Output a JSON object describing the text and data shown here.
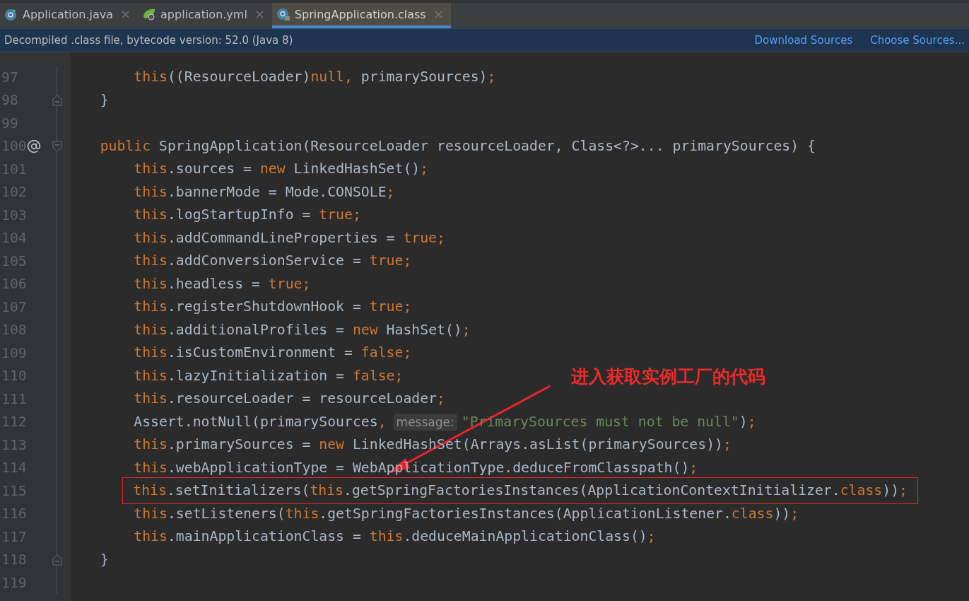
{
  "tabs": [
    {
      "label": "Application.java",
      "kind": "class",
      "selected": false
    },
    {
      "label": "application.yml",
      "kind": "spring",
      "selected": false
    },
    {
      "label": "SpringApplication.class",
      "kind": "locked-class",
      "selected": true
    }
  ],
  "banner": {
    "text": "Decompiled .class file, bytecode version: 52.0 (Java 8)",
    "links": [
      "Download Sources",
      "Choose Sources..."
    ]
  },
  "lines": [
    {
      "number": "97",
      "override": false,
      "fold_start": false,
      "fold_end": false,
      "boxed": false,
      "tokens": [
        {
          "t": "        this",
          "kind": "kw"
        },
        {
          "t": "((ResourceLoader)",
          "kind": "id"
        },
        {
          "t": "null",
          "kind": "kw"
        },
        {
          "t": ",",
          "kind": "kw"
        },
        {
          "t": " primarySources)",
          "kind": "id"
        },
        {
          "t": ";",
          "kind": "kw"
        }
      ]
    },
    {
      "number": "98",
      "override": false,
      "fold_start": false,
      "fold_end": true,
      "boxed": false,
      "tokens": [
        {
          "t": "    }",
          "kind": "id"
        }
      ]
    },
    {
      "number": "99",
      "override": false,
      "fold_start": false,
      "fold_end": false,
      "boxed": false
    },
    {
      "number": "100",
      "override": true,
      "fold_start": true,
      "fold_end": false,
      "boxed": false,
      "tokens": [
        {
          "t": "    public",
          "kind": "kw"
        },
        {
          "t": " SpringApplication(ResourceLoader resourceLoader, Class<?>... primarySources) {",
          "kind": "id"
        }
      ]
    },
    {
      "number": "101",
      "override": false,
      "fold_start": false,
      "fold_end": false,
      "boxed": false,
      "tokens": [
        {
          "t": "        this",
          "kind": "kw"
        },
        {
          "t": ".sources = ",
          "kind": "id"
        },
        {
          "t": "new",
          "kind": "kw"
        },
        {
          "t": " LinkedHashSet()",
          "kind": "id"
        },
        {
          "t": ";",
          "kind": "kw"
        }
      ]
    },
    {
      "number": "102",
      "override": false,
      "fold_start": false,
      "fold_end": false,
      "boxed": false,
      "tokens": [
        {
          "t": "        this",
          "kind": "kw"
        },
        {
          "t": ".bannerMode = Mode.CONSOLE",
          "kind": "id"
        },
        {
          "t": ";",
          "kind": "kw"
        }
      ]
    },
    {
      "number": "103",
      "override": false,
      "fold_start": false,
      "fold_end": false,
      "boxed": false,
      "tokens": [
        {
          "t": "        this",
          "kind": "kw"
        },
        {
          "t": ".logStartupInfo = ",
          "kind": "id"
        },
        {
          "t": "true",
          "kind": "kw"
        },
        {
          "t": ";",
          "kind": "kw"
        }
      ]
    },
    {
      "number": "104",
      "override": false,
      "fold_start": false,
      "fold_end": false,
      "boxed": false,
      "tokens": [
        {
          "t": "        this",
          "kind": "kw"
        },
        {
          "t": ".addCommandLineProperties = ",
          "kind": "id"
        },
        {
          "t": "true",
          "kind": "kw"
        },
        {
          "t": ";",
          "kind": "kw"
        }
      ]
    },
    {
      "number": "105",
      "override": false,
      "fold_start": false,
      "fold_end": false,
      "boxed": false,
      "tokens": [
        {
          "t": "        this",
          "kind": "kw"
        },
        {
          "t": ".addConversionService = ",
          "kind": "id"
        },
        {
          "t": "true",
          "kind": "kw"
        },
        {
          "t": ";",
          "kind": "kw"
        }
      ]
    },
    {
      "number": "106",
      "override": false,
      "fold_start": false,
      "fold_end": false,
      "boxed": false,
      "tokens": [
        {
          "t": "        this",
          "kind": "kw"
        },
        {
          "t": ".headless = ",
          "kind": "id"
        },
        {
          "t": "true",
          "kind": "kw"
        },
        {
          "t": ";",
          "kind": "kw"
        }
      ]
    },
    {
      "number": "107",
      "override": false,
      "fold_start": false,
      "fold_end": false,
      "boxed": false,
      "tokens": [
        {
          "t": "        this",
          "kind": "kw"
        },
        {
          "t": ".registerShutdownHook = ",
          "kind": "id"
        },
        {
          "t": "true",
          "kind": "kw"
        },
        {
          "t": ";",
          "kind": "kw"
        }
      ]
    },
    {
      "number": "108",
      "override": false,
      "fold_start": false,
      "fold_end": false,
      "boxed": false,
      "tokens": [
        {
          "t": "        this",
          "kind": "kw"
        },
        {
          "t": ".additionalProfiles = ",
          "kind": "id"
        },
        {
          "t": "new",
          "kind": "kw"
        },
        {
          "t": " HashSet()",
          "kind": "id"
        },
        {
          "t": ";",
          "kind": "kw"
        }
      ]
    },
    {
      "number": "109",
      "override": false,
      "fold_start": false,
      "fold_end": false,
      "boxed": false,
      "tokens": [
        {
          "t": "        this",
          "kind": "kw"
        },
        {
          "t": ".isCustomEnvironment = ",
          "kind": "id"
        },
        {
          "t": "false",
          "kind": "kw"
        },
        {
          "t": ";",
          "kind": "kw"
        }
      ]
    },
    {
      "number": "110",
      "override": false,
      "fold_start": false,
      "fold_end": false,
      "boxed": false,
      "tokens": [
        {
          "t": "        this",
          "kind": "kw"
        },
        {
          "t": ".lazyInitialization = ",
          "kind": "id"
        },
        {
          "t": "false",
          "kind": "kw"
        },
        {
          "t": ";",
          "kind": "kw"
        }
      ]
    },
    {
      "number": "111",
      "override": false,
      "fold_start": false,
      "fold_end": false,
      "boxed": false,
      "tokens": [
        {
          "t": "        this",
          "kind": "kw"
        },
        {
          "t": ".resourceLoader = resourceLoader",
          "kind": "id"
        },
        {
          "t": ";",
          "kind": "kw"
        }
      ]
    },
    {
      "number": "112",
      "override": false,
      "fold_start": false,
      "fold_end": false,
      "boxed": false,
      "tokens": [
        {
          "t": "        Assert.notNull(primarySources",
          "kind": "id"
        },
        {
          "t": ",",
          "kind": "kw"
        },
        {
          "t": "message:",
          "kind": "hint"
        },
        {
          "t": "\"PrimarySources must not be null\"",
          "kind": "str"
        },
        {
          "t": ")",
          "kind": "id"
        },
        {
          "t": ";",
          "kind": "kw"
        }
      ]
    },
    {
      "number": "113",
      "override": false,
      "fold_start": false,
      "fold_end": false,
      "boxed": false,
      "tokens": [
        {
          "t": "        this",
          "kind": "kw"
        },
        {
          "t": ".primarySources = ",
          "kind": "id"
        },
        {
          "t": "new",
          "kind": "kw"
        },
        {
          "t": " LinkedHashSet(Arrays.asList(primarySources))",
          "kind": "id"
        },
        {
          "t": ";",
          "kind": "kw"
        }
      ]
    },
    {
      "number": "114",
      "override": false,
      "fold_start": false,
      "fold_end": false,
      "boxed": false,
      "tokens": [
        {
          "t": "        this",
          "kind": "kw"
        },
        {
          "t": ".webApplicationType = WebApplicationType.deduceFromClasspath()",
          "kind": "id"
        },
        {
          "t": ";",
          "kind": "kw"
        }
      ]
    },
    {
      "number": "115",
      "override": false,
      "fold_start": false,
      "fold_end": false,
      "boxed": true,
      "tokens": [
        {
          "t": "        this",
          "kind": "kw"
        },
        {
          "t": ".setInitializers(",
          "kind": "id"
        },
        {
          "t": "this",
          "kind": "kw"
        },
        {
          "t": ".getSpringFactoriesInstances(ApplicationContextInitializer.",
          "kind": "id"
        },
        {
          "t": "class",
          "kind": "kw"
        },
        {
          "t": "))",
          "kind": "id"
        },
        {
          "t": ";",
          "kind": "kw"
        }
      ]
    },
    {
      "number": "116",
      "override": false,
      "fold_start": false,
      "fold_end": false,
      "boxed": false,
      "tokens": [
        {
          "t": "        this",
          "kind": "kw"
        },
        {
          "t": ".setListeners(",
          "kind": "id"
        },
        {
          "t": "this",
          "kind": "kw"
        },
        {
          "t": ".getSpringFactoriesInstances(ApplicationListener.",
          "kind": "id"
        },
        {
          "t": "class",
          "kind": "kw"
        },
        {
          "t": "))",
          "kind": "id"
        },
        {
          "t": ";",
          "kind": "kw"
        }
      ]
    },
    {
      "number": "117",
      "override": false,
      "fold_start": false,
      "fold_end": false,
      "boxed": false,
      "tokens": [
        {
          "t": "        this",
          "kind": "kw"
        },
        {
          "t": ".mainApplicationClass = ",
          "kind": "id"
        },
        {
          "t": "this",
          "kind": "kw"
        },
        {
          "t": ".deduceMainApplicationClass()",
          "kind": "id"
        },
        {
          "t": ";",
          "kind": "kw"
        }
      ]
    },
    {
      "number": "118",
      "override": false,
      "fold_start": false,
      "fold_end": true,
      "boxed": false,
      "tokens": [
        {
          "t": "    }",
          "kind": "id"
        }
      ]
    },
    {
      "number": "119",
      "override": false,
      "fold_start": false,
      "fold_end": false,
      "boxed": false
    }
  ],
  "annotation": {
    "label": "进入获取实例工厂的代码"
  }
}
